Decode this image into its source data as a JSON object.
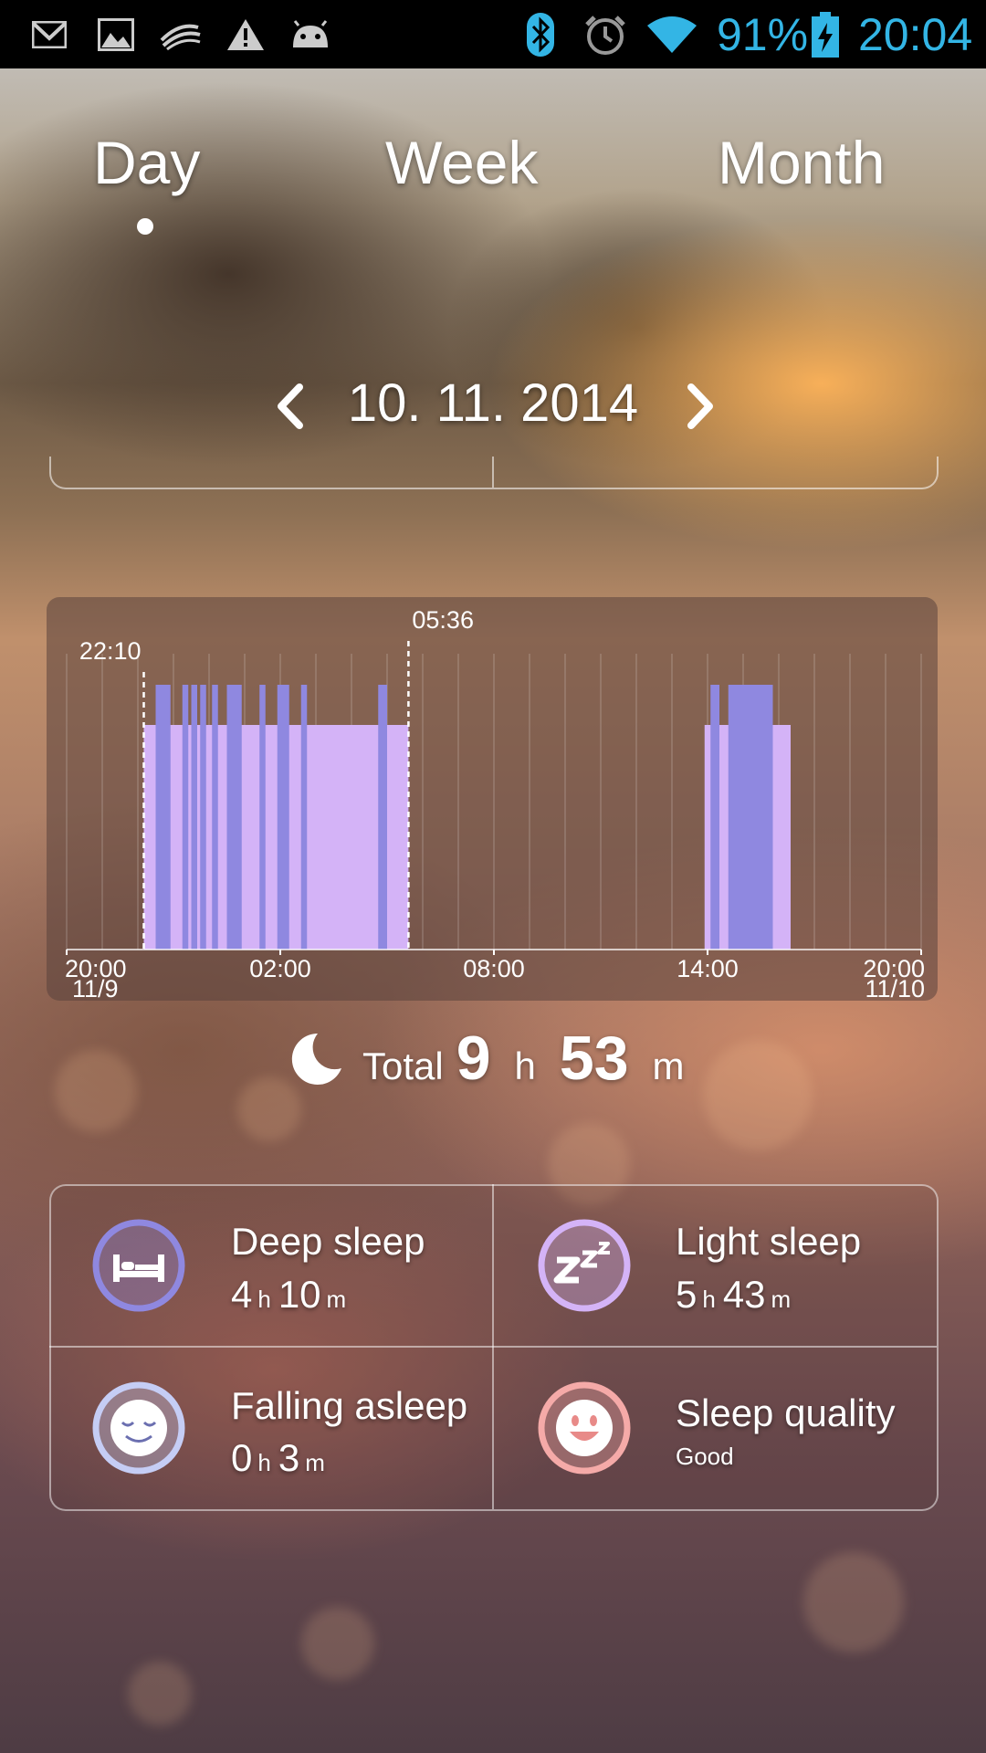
{
  "status_bar": {
    "battery": "91%",
    "time": "20:04",
    "icons": [
      "gmail-icon",
      "gallery-icon",
      "swiftkey-icon",
      "warning-icon",
      "android-icon",
      "bluetooth-icon",
      "alarm-icon",
      "wifi-icon",
      "battery-charging-icon"
    ],
    "accent": "#33b5e5"
  },
  "tabs": {
    "day": "Day",
    "week": "Week",
    "month": "Month",
    "selected": "day"
  },
  "date_nav": {
    "date": "10. 11. 2014",
    "prev_icon": "chevron-left-icon",
    "next_icon": "chevron-right-icon"
  },
  "chart_data": {
    "type": "bar",
    "start_time": "22:10",
    "end_time": "05:36",
    "x_range": [
      "20:00 11/9",
      "20:00 11/10"
    ],
    "x_ticks": [
      {
        "time": "20:00",
        "date": "11/9"
      },
      {
        "time": "02:00",
        "date": ""
      },
      {
        "time": "08:00",
        "date": ""
      },
      {
        "time": "14:00",
        "date": ""
      },
      {
        "time": "20:00",
        "date": "11/10"
      }
    ],
    "levels": {
      "deep": 2,
      "light": 1
    },
    "colors": {
      "deep": "#8f88e0",
      "light": "#d4b3f7"
    },
    "series": [
      {
        "level": "light",
        "intervals": [
          [
            "22:10",
            "05:36"
          ],
          [
            "13:55",
            "16:20"
          ]
        ]
      },
      {
        "level": "deep",
        "intervals": [
          [
            "22:30",
            "22:55"
          ],
          [
            "23:15",
            "23:25"
          ],
          [
            "23:30",
            "23:40"
          ],
          [
            "23:45",
            "23:55"
          ],
          [
            "00:05",
            "00:15"
          ],
          [
            "00:30",
            "00:55"
          ],
          [
            "01:25",
            "01:35"
          ],
          [
            "01:55",
            "02:15"
          ],
          [
            "02:35",
            "02:45"
          ],
          [
            "04:45",
            "05:00"
          ],
          [
            "14:05",
            "14:20"
          ],
          [
            "14:35",
            "15:50"
          ]
        ]
      }
    ]
  },
  "total": {
    "label": "Total",
    "hours": "9",
    "h_unit": "h",
    "minutes": "53",
    "m_unit": "m"
  },
  "stats": {
    "deep": {
      "title": "Deep sleep",
      "hours": "4",
      "minutes": "10",
      "h_unit": "h",
      "m_unit": "m",
      "icon": "bed-icon",
      "color": "#8f88e0"
    },
    "light": {
      "title": "Light sleep",
      "hours": "5",
      "minutes": "43",
      "h_unit": "h",
      "m_unit": "m",
      "icon": "zzz-icon",
      "color": "#d4b3f7"
    },
    "falling": {
      "title": "Falling asleep",
      "hours": "0",
      "minutes": "3",
      "h_unit": "h",
      "m_unit": "m",
      "icon": "sleeping-face-icon",
      "color": "#c5cdf5"
    },
    "quality": {
      "title": "Sleep quality",
      "value": "Good",
      "icon": "smiley-icon",
      "color": "#f5aaa8"
    }
  }
}
